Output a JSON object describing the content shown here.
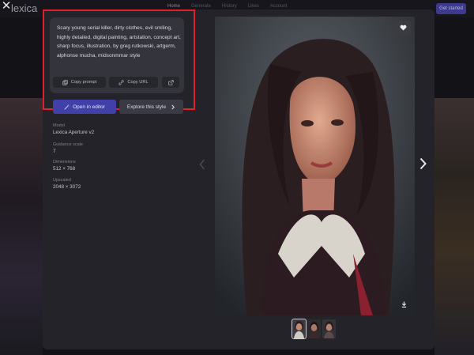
{
  "site": {
    "brand": "lexica",
    "nav": [
      "Home",
      "Generate",
      "History",
      "Likes",
      "Account"
    ],
    "cta": "Get started"
  },
  "modal": {
    "close_symbol": "✕",
    "prompt": "Scary young serial killer, dirty clothes, evil smiling, highly detailed, digital painting, artstation, concept art, sharp focus, illustration, by greg rutkowski, artgerm, alphonse mucha, midsonmmar style",
    "actions": {
      "copy_prompt": "Copy prompt",
      "copy_url": "Copy URL"
    },
    "buttons": {
      "open_editor": "Open in editor",
      "explore_style": "Explore this style"
    },
    "meta": {
      "model_label": "Model",
      "model_value": "Lexica Aperture v2",
      "guidance_label": "Guidance scale",
      "guidance_value": "7",
      "dimensions_label": "Dimensions",
      "dimensions_value": "512 × 768",
      "upscaled_label": "Upscaled",
      "upscaled_value": "2048 × 3072"
    }
  },
  "colors": {
    "accent": "#4040a8",
    "highlight": "#e0202a",
    "panel": "#232329"
  },
  "icons": [
    "close-icon",
    "copy-icon",
    "link-icon",
    "external-link-icon",
    "magic-wand-icon",
    "chevron-right-icon",
    "heart-icon",
    "download-icon",
    "chevron-left-icon"
  ]
}
